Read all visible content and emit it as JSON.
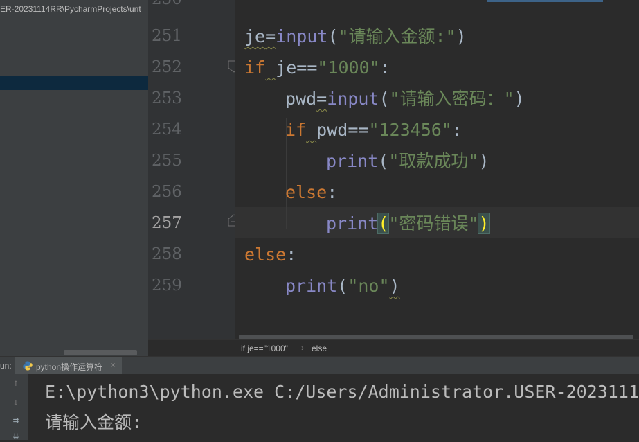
{
  "sidebar": {
    "path": "ER-20231114RR\\PycharmProjects\\unt"
  },
  "editor": {
    "line_numbers": [
      "251",
      "252",
      "253",
      "254",
      "255",
      "256",
      "257",
      "258",
      "259"
    ],
    "current_line": "257",
    "lines": {
      "l251": [
        "je",
        "=",
        "input",
        "(",
        "\"请输入金额:\"",
        ")"
      ],
      "l252": [
        "if",
        " ",
        "je",
        "==",
        "\"1000\"",
        ":"
      ],
      "l253": [
        "pwd",
        "=",
        "input",
        "(",
        "\"请输入密码：\"",
        ")"
      ],
      "l254": [
        "if",
        " ",
        "pwd",
        "==",
        "\"123456\"",
        ":"
      ],
      "l255": [
        "print",
        "(",
        "\"取款成功\"",
        ")"
      ],
      "l256": [
        "else",
        ":"
      ],
      "l257": [
        "print",
        "(",
        "\"密码错误\"",
        ")"
      ],
      "l258": [
        "else",
        ":"
      ],
      "l259": [
        "print",
        "(",
        "\"no\"",
        ")"
      ]
    }
  },
  "breadcrumb": [
    "if je==\"1000\"",
    "else"
  ],
  "run": {
    "label": "un:",
    "tab_label": "python操作运算符",
    "tab_close": "×",
    "console": [
      "E:\\python3\\python.exe C:/Users/Administrator.USER-2023111",
      "请输入金额:"
    ]
  },
  "icons": [
    "python-icon",
    "arrow-up-icon",
    "arrow-down-icon",
    "soft-wrap-icon",
    "scroll-to-end-icon",
    "fold-marker-icon"
  ],
  "colors": {
    "keyword": "#cc7832",
    "builtin": "#8888c6",
    "string": "#6a8759",
    "identifier": "#a9b7c6",
    "background": "#2b2b2b"
  }
}
